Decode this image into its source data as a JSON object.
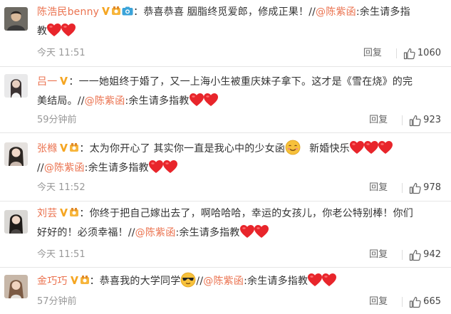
{
  "comments": [
    {
      "name": "陈浩民benny",
      "text1": "：恭喜恭喜 胭脂终觅爱郎，修成正果！",
      "mention_prefix": "//",
      "mention": "@陈紫函",
      "text2": ":余生请多指",
      "text3": "教",
      "time": "今天 11:51",
      "reply": "回复",
      "likes": "1060"
    },
    {
      "name": "吕一",
      "text1": "：一一她姐终于婚了，又一上海小生被重庆妹子拿下。这才是《雪在烧》的完",
      "text2": "美结局。",
      "mention_prefix": "//",
      "mention": "@陈紫函",
      "text3": ":余生请多指教",
      "time": "59分钟前",
      "reply": "回复",
      "likes": "923"
    },
    {
      "name": "张橼",
      "text1": "：太为你开心了 其实你一直是我心中的少女函",
      "text2": "新婚快乐",
      "mention_prefix": "//",
      "mention": "@陈紫函",
      "text3": ":余生请多指教",
      "time": "今天 11:52",
      "reply": "回复",
      "likes": "978"
    },
    {
      "name": "刘芸",
      "text1": "：你终于把自己嫁出去了，啊哈哈哈，幸运的女孩儿，你老公特别棒！你们",
      "text2": "好好的！必须幸福！",
      "mention_prefix": "//",
      "mention": "@陈紫函",
      "text3": ":余生请多指教",
      "time": "今天 11:51",
      "reply": "回复",
      "likes": "942"
    },
    {
      "name": "金巧巧",
      "text1": "：恭喜我的大学同学",
      "mention_prefix": "//",
      "mention": "@陈紫函",
      "text3": ":余生请多指教",
      "time": "57分钟前",
      "reply": "回复",
      "likes": "665"
    }
  ],
  "colors": {
    "name": "#eb7350",
    "mention": "#eb7350",
    "heart": "#e8252b",
    "vbadge": "#f5a623",
    "meta": "#999999"
  },
  "icons": [
    "verified-v-icon",
    "level-badge-icon",
    "camera-badge-icon",
    "heart-emoji",
    "smiling-emoji",
    "sunglasses-emoji",
    "thumbs-up-icon"
  ]
}
